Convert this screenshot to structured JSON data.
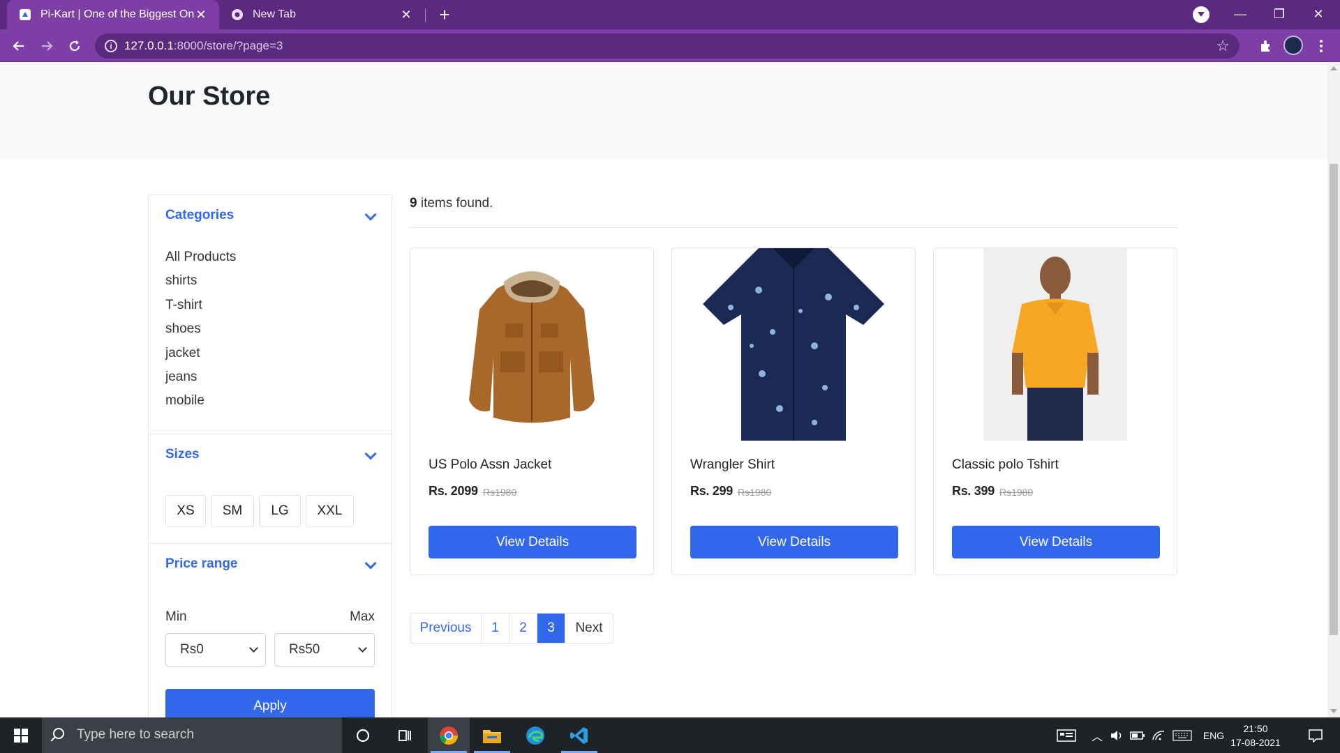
{
  "browser": {
    "tabs": [
      {
        "title": "Pi-Kart | One of the Biggest Onlin",
        "active": true
      },
      {
        "title": "New Tab",
        "active": false
      }
    ],
    "url_host": "127.0.0.1",
    "url_path": ":8000/store/?page=3"
  },
  "page": {
    "title": "Our Store"
  },
  "sidebar": {
    "categories": {
      "header": "Categories",
      "items": [
        "All Products",
        "shirts",
        "T-shirt",
        "shoes",
        "jacket",
        "jeans",
        "mobile"
      ]
    },
    "sizes": {
      "header": "Sizes",
      "items": [
        "XS",
        "SM",
        "LG",
        "XXL"
      ]
    },
    "price": {
      "header": "Price range",
      "min_label": "Min",
      "max_label": "Max",
      "min_value": "Rs0",
      "max_value": "Rs50",
      "apply_label": "Apply"
    }
  },
  "results": {
    "count": "9",
    "suffix": " items found."
  },
  "products": [
    {
      "name": "US Polo Assn Jacket",
      "price": "Rs. 2099",
      "old_price": "Rs1980",
      "button": "View Details"
    },
    {
      "name": "Wrangler Shirt",
      "price": "Rs. 299",
      "old_price": "Rs1980",
      "button": "View Details"
    },
    {
      "name": "Classic polo Tshirt",
      "price": "Rs. 399",
      "old_price": "Rs1980",
      "button": "View Details"
    }
  ],
  "pagination": {
    "previous": "Previous",
    "pages": [
      "1",
      "2",
      "3"
    ],
    "current": "3",
    "next": "Next"
  },
  "taskbar": {
    "search_placeholder": "Type here to search",
    "language": "ENG",
    "time": "21:50",
    "date": "17-08-2021"
  },
  "colors": {
    "accent": "#3167eb",
    "browser_frame": "#5b2a7e",
    "browser_toolbar": "#7d3fa6"
  }
}
